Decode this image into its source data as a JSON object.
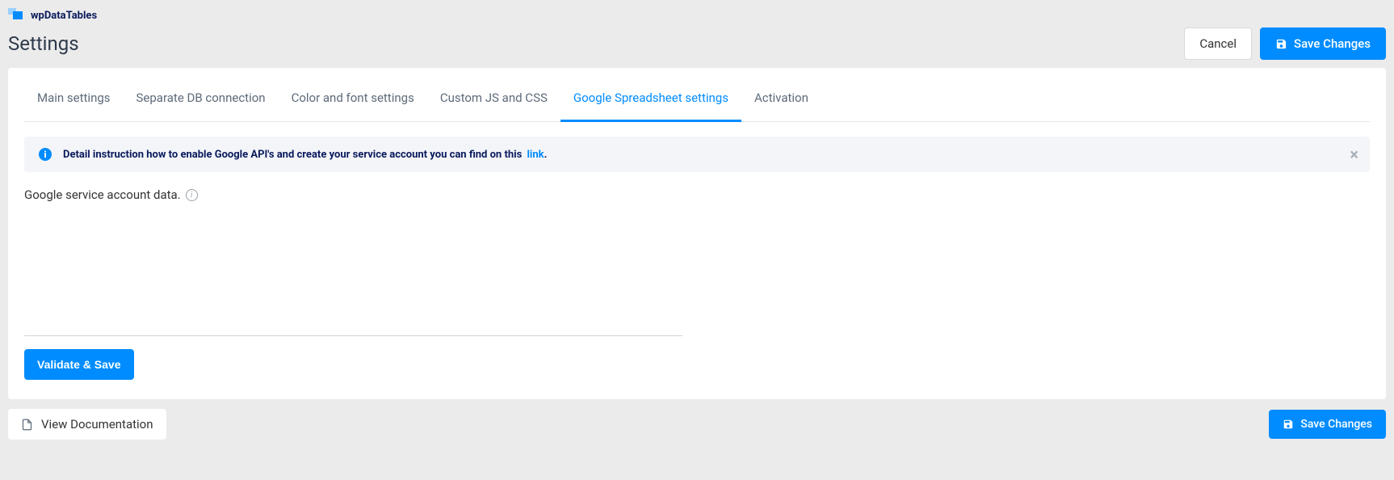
{
  "brand": "wpDataTables",
  "page_title": "Settings",
  "header": {
    "cancel_label": "Cancel",
    "save_label": "Save Changes"
  },
  "tabs": [
    {
      "label": "Main settings",
      "active": false
    },
    {
      "label": "Separate DB connection",
      "active": false
    },
    {
      "label": "Color and font settings",
      "active": false
    },
    {
      "label": "Custom JS and CSS",
      "active": false
    },
    {
      "label": "Google Spreadsheet settings",
      "active": true
    },
    {
      "label": "Activation",
      "active": false
    }
  ],
  "notice": {
    "text_before_link": "Detail instruction how to enable Google API's and create your service account you can find on this",
    "link_text": "link",
    "text_after_link": "."
  },
  "field": {
    "label": "Google service account data.",
    "value": ""
  },
  "validate_label": "Validate & Save",
  "footer": {
    "doc_label": "View Documentation",
    "save_label": "Save Changes"
  }
}
